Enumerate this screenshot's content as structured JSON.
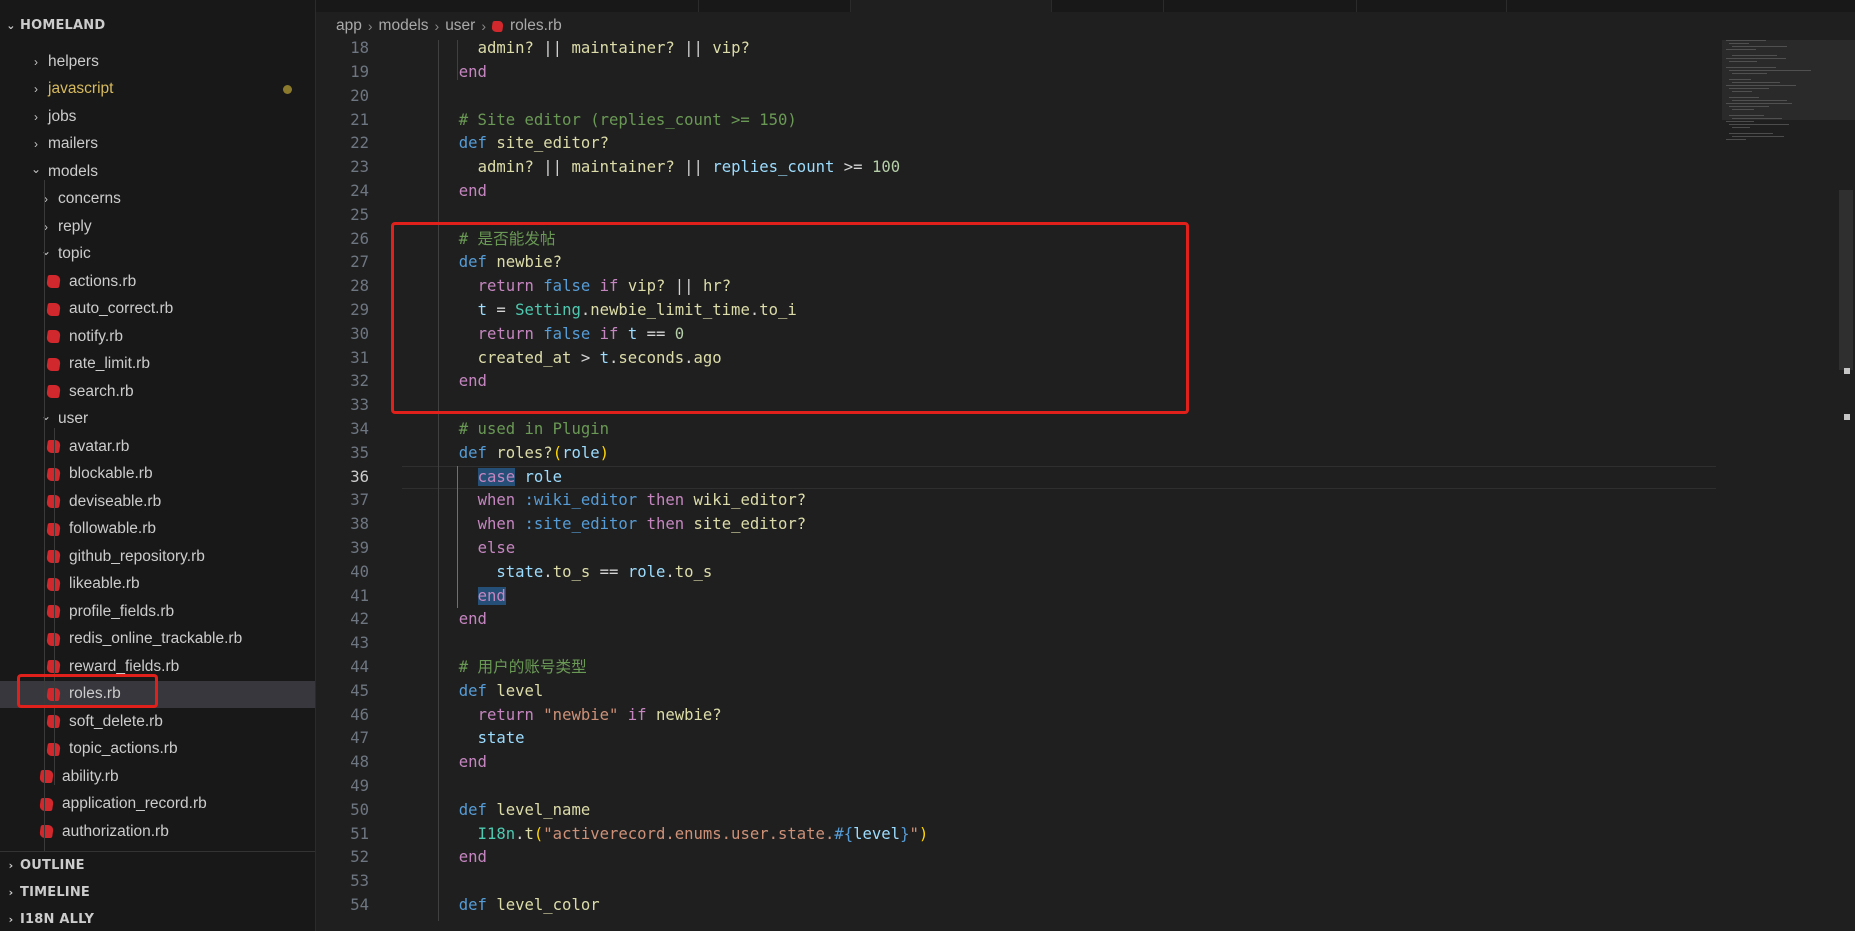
{
  "explorer": {
    "root_title": "HOMELAND",
    "items": [
      {
        "label": "helpers",
        "kind": "folder",
        "state": "collapsed",
        "depth": 1
      },
      {
        "label": "javascript",
        "kind": "folder",
        "state": "collapsed",
        "depth": 1,
        "modified": true
      },
      {
        "label": "jobs",
        "kind": "folder",
        "state": "collapsed",
        "depth": 1
      },
      {
        "label": "mailers",
        "kind": "folder",
        "state": "collapsed",
        "depth": 1
      },
      {
        "label": "models",
        "kind": "folder",
        "state": "expanded",
        "depth": 1
      },
      {
        "label": "concerns",
        "kind": "folder",
        "state": "collapsed",
        "depth": 2
      },
      {
        "label": "reply",
        "kind": "folder",
        "state": "collapsed",
        "depth": 2
      },
      {
        "label": "topic",
        "kind": "folder",
        "state": "expanded",
        "depth": 2
      },
      {
        "label": "actions.rb",
        "kind": "file",
        "depth": 3
      },
      {
        "label": "auto_correct.rb",
        "kind": "file",
        "depth": 3
      },
      {
        "label": "notify.rb",
        "kind": "file",
        "depth": 3
      },
      {
        "label": "rate_limit.rb",
        "kind": "file",
        "depth": 3
      },
      {
        "label": "search.rb",
        "kind": "file",
        "depth": 3
      },
      {
        "label": "user",
        "kind": "folder",
        "state": "expanded",
        "depth": 2
      },
      {
        "label": "avatar.rb",
        "kind": "file",
        "depth": 3
      },
      {
        "label": "blockable.rb",
        "kind": "file",
        "depth": 3
      },
      {
        "label": "deviseable.rb",
        "kind": "file",
        "depth": 3
      },
      {
        "label": "followable.rb",
        "kind": "file",
        "depth": 3
      },
      {
        "label": "github_repository.rb",
        "kind": "file",
        "depth": 3
      },
      {
        "label": "likeable.rb",
        "kind": "file",
        "depth": 3
      },
      {
        "label": "profile_fields.rb",
        "kind": "file",
        "depth": 3
      },
      {
        "label": "redis_online_trackable.rb",
        "kind": "file",
        "depth": 3
      },
      {
        "label": "reward_fields.rb",
        "kind": "file",
        "depth": 3
      },
      {
        "label": "roles.rb",
        "kind": "file",
        "depth": 3,
        "selected": true
      },
      {
        "label": "soft_delete.rb",
        "kind": "file",
        "depth": 3
      },
      {
        "label": "topic_actions.rb",
        "kind": "file",
        "depth": 3
      },
      {
        "label": "ability.rb",
        "kind": "file",
        "depth": 2
      },
      {
        "label": "application_record.rb",
        "kind": "file",
        "depth": 2
      },
      {
        "label": "authorization.rb",
        "kind": "file",
        "depth": 2
      }
    ],
    "panels": [
      "OUTLINE",
      "TIMELINE",
      "I18N ALLY"
    ]
  },
  "breadcrumb": [
    "app",
    "models",
    "user",
    "roles.rb"
  ],
  "editor": {
    "current_line": 36,
    "lines": [
      {
        "n": 18,
        "tokens": [
          [
            "    ",
            ""
          ],
          [
            "admin?",
            "fn"
          ],
          [
            " || ",
            ""
          ],
          [
            "maintainer?",
            "fn"
          ],
          [
            " || ",
            ""
          ],
          [
            "vip?",
            "fn"
          ]
        ]
      },
      {
        "n": 19,
        "tokens": [
          [
            "  ",
            ""
          ],
          [
            "end",
            "kw"
          ]
        ]
      },
      {
        "n": 20,
        "tokens": []
      },
      {
        "n": 21,
        "tokens": [
          [
            "  ",
            ""
          ],
          [
            "# Site editor (replies_count >= 150)",
            "cm"
          ]
        ]
      },
      {
        "n": 22,
        "tokens": [
          [
            "  ",
            ""
          ],
          [
            "def",
            "kwb"
          ],
          [
            " ",
            ""
          ],
          [
            "site_editor?",
            "fn"
          ]
        ]
      },
      {
        "n": 23,
        "tokens": [
          [
            "    ",
            ""
          ],
          [
            "admin?",
            "fn"
          ],
          [
            " || ",
            ""
          ],
          [
            "maintainer?",
            "fn"
          ],
          [
            " || ",
            ""
          ],
          [
            "replies_count",
            "var"
          ],
          [
            " >= ",
            ""
          ],
          [
            "100",
            "num"
          ]
        ]
      },
      {
        "n": 24,
        "tokens": [
          [
            "  ",
            ""
          ],
          [
            "end",
            "kw"
          ]
        ]
      },
      {
        "n": 25,
        "tokens": []
      },
      {
        "n": 26,
        "tokens": [
          [
            "  ",
            ""
          ],
          [
            "# 是否能发帖",
            "cm"
          ]
        ]
      },
      {
        "n": 27,
        "tokens": [
          [
            "  ",
            ""
          ],
          [
            "def",
            "kwb"
          ],
          [
            " ",
            ""
          ],
          [
            "newbie?",
            "fn"
          ]
        ]
      },
      {
        "n": 28,
        "tokens": [
          [
            "    ",
            ""
          ],
          [
            "return",
            "kw"
          ],
          [
            " ",
            ""
          ],
          [
            "false",
            "kwb"
          ],
          [
            " ",
            ""
          ],
          [
            "if",
            "kw"
          ],
          [
            " ",
            ""
          ],
          [
            "vip?",
            "fn"
          ],
          [
            " || ",
            ""
          ],
          [
            "hr?",
            "fn"
          ]
        ]
      },
      {
        "n": 29,
        "tokens": [
          [
            "    ",
            ""
          ],
          [
            "t",
            "var"
          ],
          [
            " = ",
            ""
          ],
          [
            "Setting",
            "cls"
          ],
          [
            ".",
            ""
          ],
          [
            "newbie_limit_time",
            "fn"
          ],
          [
            ".",
            ""
          ],
          [
            "to_i",
            "fn"
          ]
        ]
      },
      {
        "n": 30,
        "tokens": [
          [
            "    ",
            ""
          ],
          [
            "return",
            "kw"
          ],
          [
            " ",
            ""
          ],
          [
            "false",
            "kwb"
          ],
          [
            " ",
            ""
          ],
          [
            "if",
            "kw"
          ],
          [
            " ",
            ""
          ],
          [
            "t",
            "var"
          ],
          [
            " == ",
            ""
          ],
          [
            "0",
            "num"
          ]
        ]
      },
      {
        "n": 31,
        "tokens": [
          [
            "    ",
            ""
          ],
          [
            "created_at",
            "fn"
          ],
          [
            " > ",
            ""
          ],
          [
            "t",
            "var"
          ],
          [
            ".",
            ""
          ],
          [
            "seconds",
            "fn"
          ],
          [
            ".",
            ""
          ],
          [
            "ago",
            "fn"
          ]
        ]
      },
      {
        "n": 32,
        "tokens": [
          [
            "  ",
            ""
          ],
          [
            "end",
            "kw"
          ]
        ]
      },
      {
        "n": 33,
        "tokens": []
      },
      {
        "n": 34,
        "tokens": [
          [
            "  ",
            ""
          ],
          [
            "# used in Plugin",
            "cm"
          ]
        ]
      },
      {
        "n": 35,
        "tokens": [
          [
            "  ",
            ""
          ],
          [
            "def",
            "kwb"
          ],
          [
            " ",
            ""
          ],
          [
            "roles?",
            "fn"
          ],
          [
            "(",
            "br1"
          ],
          [
            "role",
            "var"
          ],
          [
            ")",
            "br1"
          ]
        ]
      },
      {
        "n": 36,
        "tokens": [
          [
            "    ",
            ""
          ],
          [
            "case",
            "kw case-hl"
          ],
          [
            " ",
            ""
          ],
          [
            "role",
            "var"
          ]
        ]
      },
      {
        "n": 37,
        "tokens": [
          [
            "    ",
            ""
          ],
          [
            "when",
            "kw"
          ],
          [
            " ",
            ""
          ],
          [
            ":wiki_editor",
            "sym"
          ],
          [
            " ",
            ""
          ],
          [
            "then",
            "kw"
          ],
          [
            " ",
            ""
          ],
          [
            "wiki_editor?",
            "fn"
          ]
        ]
      },
      {
        "n": 38,
        "tokens": [
          [
            "    ",
            ""
          ],
          [
            "when",
            "kw"
          ],
          [
            " ",
            ""
          ],
          [
            ":site_editor",
            "sym"
          ],
          [
            " ",
            ""
          ],
          [
            "then",
            "kw"
          ],
          [
            " ",
            ""
          ],
          [
            "site_editor?",
            "fn"
          ]
        ]
      },
      {
        "n": 39,
        "tokens": [
          [
            "    ",
            ""
          ],
          [
            "else",
            "kw"
          ]
        ]
      },
      {
        "n": 40,
        "tokens": [
          [
            "      ",
            ""
          ],
          [
            "state",
            "var"
          ],
          [
            ".",
            ""
          ],
          [
            "to_s",
            "fn"
          ],
          [
            " == ",
            ""
          ],
          [
            "role",
            "var"
          ],
          [
            ".",
            ""
          ],
          [
            "to_s",
            "fn"
          ]
        ]
      },
      {
        "n": 41,
        "tokens": [
          [
            "    ",
            ""
          ],
          [
            "end",
            "kw case-hl"
          ]
        ]
      },
      {
        "n": 42,
        "tokens": [
          [
            "  ",
            ""
          ],
          [
            "end",
            "kw"
          ]
        ]
      },
      {
        "n": 43,
        "tokens": []
      },
      {
        "n": 44,
        "tokens": [
          [
            "  ",
            ""
          ],
          [
            "# 用户的账号类型",
            "cm"
          ]
        ]
      },
      {
        "n": 45,
        "tokens": [
          [
            "  ",
            ""
          ],
          [
            "def",
            "kwb"
          ],
          [
            " ",
            ""
          ],
          [
            "level",
            "fn"
          ]
        ]
      },
      {
        "n": 46,
        "tokens": [
          [
            "    ",
            ""
          ],
          [
            "return",
            "kw"
          ],
          [
            " ",
            ""
          ],
          [
            "\"newbie\"",
            "str"
          ],
          [
            " ",
            ""
          ],
          [
            "if",
            "kw"
          ],
          [
            " ",
            ""
          ],
          [
            "newbie?",
            "fn"
          ]
        ]
      },
      {
        "n": 47,
        "tokens": [
          [
            "    ",
            ""
          ],
          [
            "state",
            "var"
          ]
        ]
      },
      {
        "n": 48,
        "tokens": [
          [
            "  ",
            ""
          ],
          [
            "end",
            "kw"
          ]
        ]
      },
      {
        "n": 49,
        "tokens": []
      },
      {
        "n": 50,
        "tokens": [
          [
            "  ",
            ""
          ],
          [
            "def",
            "kwb"
          ],
          [
            " ",
            ""
          ],
          [
            "level_name",
            "fn"
          ]
        ]
      },
      {
        "n": 51,
        "tokens": [
          [
            "    ",
            ""
          ],
          [
            "I18n",
            "cls"
          ],
          [
            ".",
            ""
          ],
          [
            "t",
            "fn"
          ],
          [
            "(",
            "br1"
          ],
          [
            "\"activerecord.enums.user.state.",
            "str"
          ],
          [
            "#{",
            "kwb"
          ],
          [
            "level",
            "var"
          ],
          [
            "}",
            "kwb"
          ],
          [
            "\"",
            "str"
          ],
          [
            ")",
            "br1"
          ]
        ]
      },
      {
        "n": 52,
        "tokens": [
          [
            "  ",
            ""
          ],
          [
            "end",
            "kw"
          ]
        ]
      },
      {
        "n": 53,
        "tokens": []
      },
      {
        "n": 54,
        "tokens": [
          [
            "  ",
            ""
          ],
          [
            "def",
            "kwb"
          ],
          [
            " ",
            ""
          ],
          [
            "level_color",
            "fn"
          ]
        ]
      }
    ]
  },
  "colors": {
    "annotation": "#e0201a",
    "ruby_icon": "#d0282d",
    "modified_dot": "#8b7a2b"
  }
}
